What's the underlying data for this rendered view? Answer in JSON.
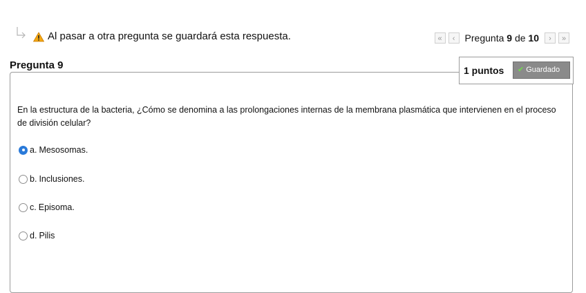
{
  "notice": {
    "text": "Al pasar a otra pregunta se guardará esta respuesta.",
    "icon": "warning-icon"
  },
  "pager": {
    "prefix": "Pregunta",
    "current": "9",
    "of": "de",
    "total": "10",
    "first_icon": "«",
    "prev_icon": "‹",
    "next_icon": "›",
    "last_icon": "»"
  },
  "question": {
    "title": "Pregunta 9",
    "points": "1 puntos",
    "status": "Guardado",
    "text": "En la estructura de la bacteria, ¿Cómo se denomina a las prolongaciones internas de la membrana plasmática que intervienen en el proceso de división celular?",
    "options": [
      {
        "letter": "a.",
        "text": "Mesosomas.",
        "selected": true
      },
      {
        "letter": "b.",
        "text": "Inclusiones.",
        "selected": false
      },
      {
        "letter": "c.",
        "text": "Episoma.",
        "selected": false
      },
      {
        "letter": "d.",
        "text": "Pilis",
        "selected": false
      }
    ]
  },
  "colors": {
    "accent": "#2a7ad9",
    "status_bg": "#8a8a8a",
    "check": "#6fdc4a",
    "warning": "#f3a712"
  }
}
